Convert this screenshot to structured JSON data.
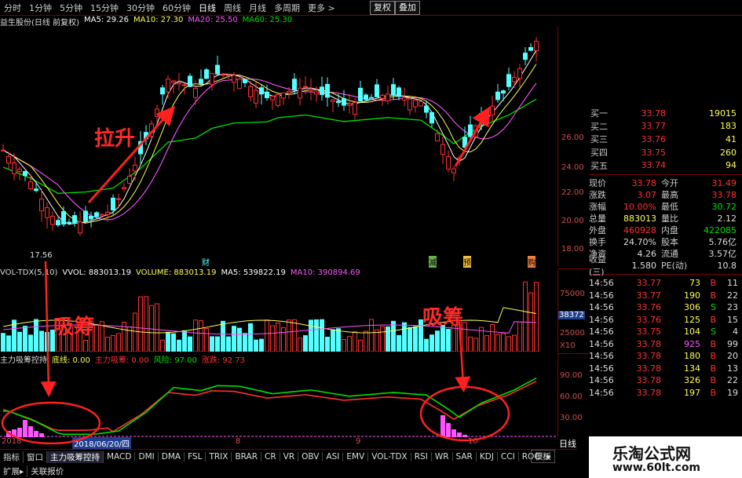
{
  "toolbar": {
    "tabs": [
      "分时",
      "1分钟",
      "5分钟",
      "15分钟",
      "30分钟",
      "60分钟",
      "日线",
      "周线",
      "月线",
      "多周期",
      "更多 >"
    ],
    "active_tab": "日线",
    "right_buttons": [
      "复权",
      "叠加"
    ]
  },
  "price_legend": {
    "title": "益生股份(日线 前复权)",
    "ma5": "MA5: 29.26",
    "ma10": "MA10: 27.30",
    "ma20": "MA20: 25.50",
    "ma60": "MA60: 25.30"
  },
  "price_axis": [
    "26.00",
    "24.00",
    "22.00",
    "20.00",
    "18.00"
  ],
  "low_label": "17.56",
  "markers": {
    "cai": "财",
    "jian": "减",
    "yu": "预",
    "gou": "购"
  },
  "vol_legend": {
    "name": "VOL-TDX(5,10)",
    "vvol": "VVOL: 883013.19",
    "volume": "VOLUME: 883013.19",
    "ma5": "MA5: 539822.19",
    "ma10": "MA10: 390894.69"
  },
  "vol_axis": [
    "75000",
    "38372",
    "25000",
    "X10"
  ],
  "ind_legend": {
    "name": "主力吸筹控持",
    "dixian": "底线: 0.00",
    "zlxc": "主力吸筹: 0.00",
    "fengxian": "风险: 97.00",
    "zhangdie": "涨跌: 92.73"
  },
  "ind_axis": [
    "90.00",
    "60.00",
    "30.00"
  ],
  "date_label": "2018/06/20/四",
  "month_labels": [
    "8",
    "9",
    "10"
  ],
  "year_label": "2018",
  "annotations": {
    "lasheng": "拉升",
    "xichou1": "吸筹",
    "xichou2": "吸筹"
  },
  "quotes": [
    {
      "label": "买一",
      "price": "33.78",
      "vol": "19015"
    },
    {
      "label": "买二",
      "price": "33.77",
      "vol": "183"
    },
    {
      "label": "买三",
      "price": "33.76",
      "vol": "41"
    },
    {
      "label": "买四",
      "price": "33.75",
      "vol": "260"
    },
    {
      "label": "买五",
      "price": "33.74",
      "vol": "94"
    }
  ],
  "stats": [
    {
      "l1": "现价",
      "v1": "33.78",
      "l2": "今开",
      "v2": "31.49"
    },
    {
      "l1": "涨跌",
      "v1": "3.07",
      "l2": "最高",
      "v2": "33.78"
    },
    {
      "l1": "涨幅",
      "v1": "10.00%",
      "l2": "最低",
      "v2": "30.72"
    },
    {
      "l1": "总量",
      "v1": "883013",
      "l2": "量比",
      "v2": "2.12"
    },
    {
      "l1": "外盘",
      "v1": "460928",
      "l2": "内盘",
      "v2": "422085"
    },
    {
      "l1": "换手",
      "v1": "24.70%",
      "l2": "股本",
      "v2": "5.76亿"
    },
    {
      "l1": "净资",
      "v1": "4.26",
      "l2": "流通",
      "v2": "3.57亿"
    },
    {
      "l1": "收益(三)",
      "v1": "1.580",
      "l2": "PE(动)",
      "v2": "10.8"
    }
  ],
  "trades": [
    {
      "time": "14:56",
      "price": "33.77",
      "vol": "73",
      "side": "B",
      "n": "11"
    },
    {
      "time": "14:56",
      "price": "33.77",
      "vol": "190",
      "side": "B",
      "n": "22"
    },
    {
      "time": "14:56",
      "price": "33.76",
      "vol": "306",
      "side": "S",
      "n": "23"
    },
    {
      "time": "14:56",
      "price": "33.76",
      "vol": "125",
      "side": "B",
      "n": "15"
    },
    {
      "time": "14:56",
      "price": "33.75",
      "vol": "104",
      "side": "S",
      "n": "4"
    },
    {
      "time": "14:56",
      "price": "33.78",
      "vol": "925",
      "side": "B",
      "n": "99"
    },
    {
      "time": "14:56",
      "price": "33.78",
      "vol": "180",
      "side": "B",
      "n": "20"
    },
    {
      "time": "14:56",
      "price": "33.78",
      "vol": "134",
      "side": "B",
      "n": "13"
    },
    {
      "time": "14:56",
      "price": "33.78",
      "vol": "326",
      "side": "B",
      "n": "22"
    },
    {
      "time": "14:56",
      "price": "33.78",
      "vol": "197",
      "side": "B",
      "n": "19"
    }
  ],
  "bottom_tabs": [
    "指标",
    "窗口",
    "主力吸筹控持",
    "MACD",
    "DMI",
    "DMA",
    "FSL",
    "TRIX",
    "BRAR",
    "CR",
    "VR",
    "OBV",
    "ASI",
    "EMV",
    "VOL-TDX",
    "RSI",
    "WR",
    "SAR",
    "KDJ",
    "CCI",
    "ROC",
    "▸"
  ],
  "bottom_right": {
    "mode": "模板",
    "period": "日线"
  },
  "bottom2_tabs": [
    "扩展▸",
    "关联报价"
  ],
  "watermark": {
    "title": "乐淘公式网",
    "url": "www.60lt.com"
  },
  "colors": {
    "up": "#ff3030",
    "down": "#54ffff",
    "ma5": "#ffffff",
    "ma10": "#ffff54",
    "ma20": "#ff54ff",
    "ma60": "#00e000"
  }
}
